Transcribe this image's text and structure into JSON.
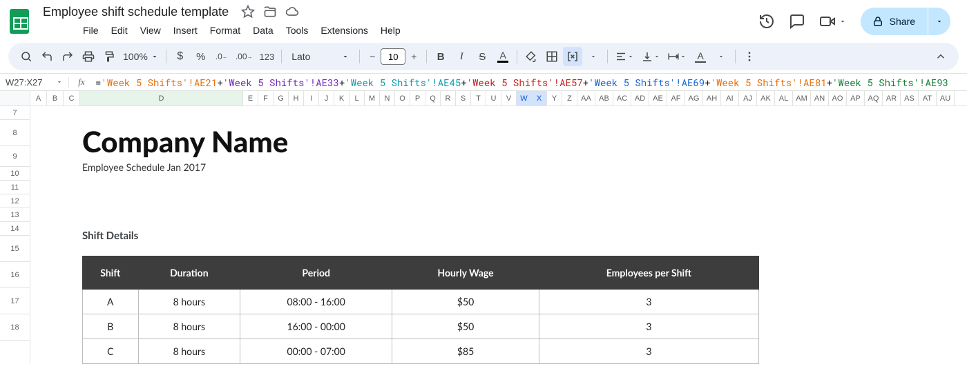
{
  "doc": {
    "title": "Employee shift schedule template"
  },
  "menubar": [
    "File",
    "Edit",
    "View",
    "Insert",
    "Format",
    "Data",
    "Tools",
    "Extensions",
    "Help"
  ],
  "toolbar": {
    "zoom": "100%",
    "font": "Lato",
    "font_size": "10"
  },
  "share_label": "Share",
  "name_box": "W27:X27",
  "formula": {
    "parts": [
      {
        "t": "=",
        "c": "#202124"
      },
      {
        "t": "'Week 5 Shifts'!AE21",
        "c": "#e8710a"
      },
      {
        "t": "+",
        "c": "#202124"
      },
      {
        "t": "'Week 5 Shifts'!AE33",
        "c": "#7627bb"
      },
      {
        "t": "+",
        "c": "#202124"
      },
      {
        "t": "'Week 5 Shifts'!AE45",
        "c": "#129eaf"
      },
      {
        "t": "+",
        "c": "#202124"
      },
      {
        "t": "'Week 5 Shifts'!AE57",
        "c": "#c5221f"
      },
      {
        "t": "+",
        "c": "#202124"
      },
      {
        "t": "'Week 5 Shifts'!AE69",
        "c": "#1967d2"
      },
      {
        "t": "+",
        "c": "#202124"
      },
      {
        "t": "'Week 5 Shifts'!AE81",
        "c": "#e8710a"
      },
      {
        "t": "+",
        "c": "#202124"
      },
      {
        "t": "'Week 5 Shifts'!AE93",
        "c": "#188038"
      }
    ]
  },
  "columns": [
    "A",
    "B",
    "C",
    "D",
    "E",
    "F",
    "G",
    "H",
    "I",
    "J",
    "K",
    "L",
    "M",
    "N",
    "O",
    "P",
    "Q",
    "R",
    "S",
    "T",
    "U",
    "V",
    "W",
    "X",
    "Y",
    "Z",
    "AA",
    "AB",
    "AC",
    "AD",
    "AE",
    "AF",
    "AG",
    "AH",
    "AI",
    "AJ",
    "AK",
    "AL",
    "AM",
    "AN",
    "AO",
    "AP",
    "AQ",
    "AR",
    "AS",
    "AT",
    "AU"
  ],
  "selected_columns": [
    "W",
    "X"
  ],
  "wide_column": "D",
  "rows": [
    7,
    8,
    9,
    10,
    11,
    12,
    13,
    14,
    15,
    16,
    17,
    18
  ],
  "tall_rows": [
    8,
    15,
    16,
    17,
    18
  ],
  "mid_rows": [
    9
  ],
  "content": {
    "company": "Company Name",
    "subtitle": "Employee Schedule Jan 2017",
    "section": "Shift Details",
    "headers": [
      "Shift",
      "Duration",
      "Period",
      "Hourly Wage",
      "Employees per Shift"
    ],
    "rows": [
      [
        "A",
        "8 hours",
        "08:00 - 16:00",
        "$50",
        "3"
      ],
      [
        "B",
        "8 hours",
        "16:00 - 00:00",
        "$50",
        "3"
      ],
      [
        "C",
        "8 hours",
        "00:00 - 07:00",
        "$85",
        "3"
      ]
    ]
  }
}
